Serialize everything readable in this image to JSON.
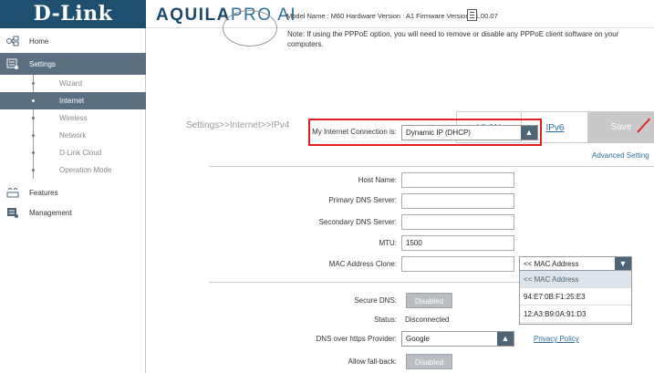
{
  "header": {
    "logo": "D-Link",
    "brand_part1": "AQUILA",
    "brand_part2": "PRO AI",
    "model_info": "Model Name : M60 Hardware Version : A1 Firmware Version : 1.00.07"
  },
  "sidebar": {
    "home": "Home",
    "settings": "Settings",
    "sub_items": [
      "Wizard",
      "Internet",
      "Wireless",
      "Network",
      "D-Link Cloud",
      "Operation Mode"
    ],
    "features": "Features",
    "management": "Management"
  },
  "content": {
    "notice": "Note: If using the PPPoE option, you will need to remove or disable any PPPoE client software on your computers.",
    "breadcrumb": "Settings>>Internet>>IPv4",
    "tabs": {
      "vlan": "VLAN",
      "ipv6": "IPv6"
    },
    "save": "Save",
    "connection_label": "My Internet Connection is:",
    "connection_value": "Dynamic IP (DHCP)",
    "advanced_link": "Advanced Setting",
    "fields": {
      "host_name": {
        "label": "Host Name:",
        "value": ""
      },
      "primary_dns": {
        "label": "Primary DNS Server:",
        "value": ""
      },
      "secondary_dns": {
        "label": "Secondary DNS Server:",
        "value": ""
      },
      "mtu": {
        "label": "MTU:",
        "value": "1500"
      },
      "mac_clone": {
        "label": "MAC Address Clone:",
        "value": ""
      }
    },
    "mac_select_value": "<< MAC Address",
    "mac_dropdown_options": [
      "<< MAC Address",
      "94:E7:0B:F1:25:E3",
      "12:A3:B9:0A:91:D3"
    ],
    "secure_dns": {
      "label": "Secure DNS:",
      "value": "Disabled"
    },
    "status": {
      "label": "Status:",
      "value": "Disconnected"
    },
    "doh_provider": {
      "label": "DNS over https Provider:",
      "value": "Google"
    },
    "privacy_link": "Privacy Policy",
    "fallback": {
      "label": "Allow fall-back:",
      "value": "Disabled"
    }
  },
  "colors": {
    "logo_bg": "#1e4f6e",
    "nav_active": "#5b6f80",
    "highlight": "#e02020",
    "link": "#2b6f99"
  }
}
